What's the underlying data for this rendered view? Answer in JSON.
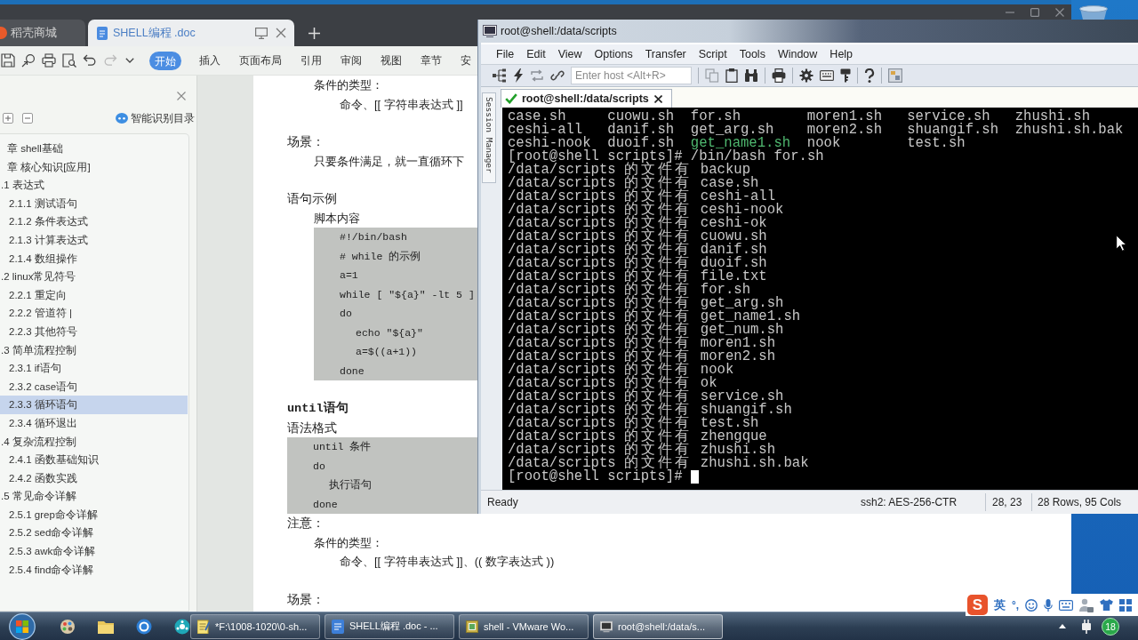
{
  "wps": {
    "tabs": [
      {
        "label": "稻壳商城",
        "selected": false
      },
      {
        "label": "SHELL编程 .doc",
        "selected": true
      }
    ],
    "quick_access": {
      "undo": {
        "disabled": false
      },
      "redo": {
        "disabled": true
      }
    },
    "ribbon_tabs": [
      {
        "label": "开始",
        "selected": true
      },
      {
        "label": "插入",
        "selected": false
      },
      {
        "label": "页面布局",
        "selected": false
      },
      {
        "label": "引用",
        "selected": false
      },
      {
        "label": "审阅",
        "selected": false
      },
      {
        "label": "视图",
        "selected": false
      },
      {
        "label": "章节",
        "selected": false
      },
      {
        "label": "安",
        "selected": false
      }
    ],
    "navigation": {
      "title": "智能识别目录",
      "items": [
        {
          "label": "章 shell基础",
          "selected": false
        },
        {
          "label": "章 核心知识[应用]",
          "selected": false,
          "children": [
            {
              "label": ".1 表达式",
              "selected": false,
              "children": [
                {
                  "label": "2.1.1 测试语句",
                  "selected": false
                },
                {
                  "label": "2.1.2 条件表达式",
                  "selected": false
                },
                {
                  "label": "2.1.3 计算表达式",
                  "selected": false
                },
                {
                  "label": "2.1.4 数组操作",
                  "selected": false
                }
              ]
            },
            {
              "label": ".2 linux常见符号",
              "selected": false,
              "children": [
                {
                  "label": "2.2.1 重定向",
                  "selected": false
                },
                {
                  "label": "2.2.2 管道符 |",
                  "selected": false
                },
                {
                  "label": "2.2.3 其他符号",
                  "selected": false
                }
              ]
            },
            {
              "label": ".3 简单流程控制",
              "selected": false,
              "children": [
                {
                  "label": "2.3.1 if语句",
                  "selected": false
                },
                {
                  "label": "2.3.2 case语句",
                  "selected": false
                },
                {
                  "label": "2.3.3 循环语句",
                  "selected": true
                },
                {
                  "label": "2.3.4 循环退出",
                  "selected": false
                }
              ]
            },
            {
              "label": ".4 复杂流程控制",
              "selected": false,
              "children": [
                {
                  "label": "2.4.1 函数基础知识",
                  "selected": false
                },
                {
                  "label": "2.4.2 函数实践",
                  "selected": false
                }
              ]
            },
            {
              "label": ".5 常见命令详解",
              "selected": false,
              "children": [
                {
                  "label": "2.5.1 grep命令详解",
                  "selected": false
                },
                {
                  "label": "2.5.2 sed命令详解",
                  "selected": false
                },
                {
                  "label": "2.5.3 awk命令详解",
                  "selected": false
                },
                {
                  "label": "2.5.4 find命令详解",
                  "selected": false
                }
              ]
            }
          ]
        }
      ]
    },
    "document": {
      "sections": [
        {
          "blocks": [
            {
              "kind": "body",
              "text": "条件的类型："
            },
            {
              "kind": "indented",
              "text": "命令、[[ 字符串表达式 ]]"
            }
          ]
        },
        {
          "blocks": [
            {
              "kind": "heading",
              "text": "场景："
            },
            {
              "kind": "body",
              "text": "只要条件满足，就一直循环下"
            }
          ]
        },
        {
          "blocks": [
            {
              "kind": "heading",
              "text": "语句示例"
            },
            {
              "kind": "body",
              "text": "脚本内容"
            },
            {
              "kind": "script",
              "lines": [
                {
                  "text": "#!/bin/bash"
                },
                {
                  "text": "# while 的示例"
                },
                {
                  "text": "a=1"
                },
                {
                  "text": "while [ \"${a}\" -lt 5 ]"
                },
                {
                  "text": "do",
                  "children": [
                    {
                      "text": "echo \"${a}\""
                    },
                    {
                      "text": "a=$((a+1))"
                    }
                  ]
                },
                {
                  "text": "done"
                }
              ]
            }
          ]
        },
        {
          "blocks": [
            {
              "kind": "title",
              "text": "until语句"
            },
            {
              "kind": "heading",
              "text": "语法格式"
            },
            {
              "kind": "syntax",
              "lines": [
                {
                  "text": "until 条件"
                },
                {
                  "text": "do",
                  "children": [
                    {
                      "text": "执行语句"
                    }
                  ]
                },
                {
                  "text": "done"
                }
              ]
            },
            {
              "kind": "heading",
              "text": "注意："
            },
            {
              "kind": "body",
              "text": "条件的类型："
            },
            {
              "kind": "indented",
              "text": "命令、[[ 字符串表达式 ]]、(( 数字表达式 ))"
            }
          ]
        },
        {
          "blocks": [
            {
              "kind": "heading",
              "text": "场景："
            }
          ]
        }
      ]
    }
  },
  "terminal": {
    "title": "root@shell:/data/scripts",
    "menu": [
      "File",
      "Edit",
      "View",
      "Options",
      "Transfer",
      "Script",
      "Tools",
      "Window",
      "Help"
    ],
    "host_field": {
      "placeholder": "Enter host <Alt+R>"
    },
    "side_tab": "Session Manager",
    "session_tabs": [
      {
        "label": "root@shell:/data/scripts",
        "selected": true,
        "connected": true
      }
    ],
    "lines": [
      {
        "kind": "ls",
        "entries": [
          {
            "name": "case.sh",
            "color": "#c8c8c8"
          },
          {
            "name": "cuowu.sh",
            "color": "#c8c8c8"
          },
          {
            "name": "for.sh",
            "color": "#c8c8c8"
          },
          {
            "name": "moren1.sh",
            "color": "#c8c8c8"
          },
          {
            "name": "service.sh",
            "color": "#c8c8c8"
          },
          {
            "name": "zhushi.sh",
            "color": "#c8c8c8"
          }
        ]
      },
      {
        "kind": "ls",
        "entries": [
          {
            "name": "ceshi-all",
            "color": "#c8c8c8"
          },
          {
            "name": "danif.sh",
            "color": "#c8c8c8"
          },
          {
            "name": "get_arg.sh",
            "color": "#c8c8c8"
          },
          {
            "name": "moren2.sh",
            "color": "#c8c8c8"
          },
          {
            "name": "shuangif.sh",
            "color": "#c8c8c8"
          },
          {
            "name": "zhushi.sh.bak",
            "color": "#c8c8c8"
          }
        ]
      },
      {
        "kind": "ls",
        "entries": [
          {
            "name": "ceshi-nook",
            "color": "#c8c8c8"
          },
          {
            "name": "duoif.sh",
            "color": "#c8c8c8"
          },
          {
            "name": "get_name1.sh",
            "color": "#4fb86f"
          },
          {
            "name": "nook",
            "color": "#c8c8c8"
          },
          {
            "name": "test.sh",
            "color": "#c8c8c8"
          }
        ]
      },
      {
        "kind": "text",
        "text": "[root@shell scripts]# /bin/bash for.sh"
      },
      {
        "kind": "text",
        "text": "/data/scripts 的文件有 backup"
      },
      {
        "kind": "text",
        "text": "/data/scripts 的文件有 case.sh"
      },
      {
        "kind": "text",
        "text": "/data/scripts 的文件有 ceshi-all"
      },
      {
        "kind": "text",
        "text": "/data/scripts 的文件有 ceshi-nook"
      },
      {
        "kind": "text",
        "text": "/data/scripts 的文件有 ceshi-ok"
      },
      {
        "kind": "text",
        "text": "/data/scripts 的文件有 cuowu.sh"
      },
      {
        "kind": "text",
        "text": "/data/scripts 的文件有 danif.sh"
      },
      {
        "kind": "text",
        "text": "/data/scripts 的文件有 duoif.sh"
      },
      {
        "kind": "text",
        "text": "/data/scripts 的文件有 file.txt"
      },
      {
        "kind": "text",
        "text": "/data/scripts 的文件有 for.sh"
      },
      {
        "kind": "text",
        "text": "/data/scripts 的文件有 get_arg.sh"
      },
      {
        "kind": "text",
        "text": "/data/scripts 的文件有 get_name1.sh"
      },
      {
        "kind": "text",
        "text": "/data/scripts 的文件有 get_num.sh"
      },
      {
        "kind": "text",
        "text": "/data/scripts 的文件有 moren1.sh"
      },
      {
        "kind": "text",
        "text": "/data/scripts 的文件有 moren2.sh"
      },
      {
        "kind": "text",
        "text": "/data/scripts 的文件有 nook"
      },
      {
        "kind": "text",
        "text": "/data/scripts 的文件有 ok"
      },
      {
        "kind": "text",
        "text": "/data/scripts 的文件有 service.sh"
      },
      {
        "kind": "text",
        "text": "/data/scripts 的文件有 shuangif.sh"
      },
      {
        "kind": "text",
        "text": "/data/scripts 的文件有 test.sh"
      },
      {
        "kind": "text",
        "text": "/data/scripts 的文件有 zhengque"
      },
      {
        "kind": "text",
        "text": "/data/scripts 的文件有 zhushi.sh"
      },
      {
        "kind": "text",
        "text": "/data/scripts 的文件有 zhushi.sh.bak"
      },
      {
        "kind": "prompt",
        "text": "[root@shell scripts]#"
      }
    ],
    "status": {
      "state": "Ready",
      "cipher": "ssh2: AES-256-CTR",
      "cursor": "28, 23",
      "size": "28 Rows, 95 Cols"
    }
  },
  "ime": {
    "logo": "S",
    "mode": "英",
    "punctuation": "°,"
  },
  "taskbar": {
    "buttons": [
      {
        "label": "*F:\\1008-1020\\0-sh...",
        "selected": false
      },
      {
        "label": "SHELL编程 .doc - ...",
        "selected": false
      },
      {
        "label": "shell - VMware Wo...",
        "selected": false
      },
      {
        "label": "root@shell:/data/s...",
        "selected": true
      }
    ],
    "tray_badge": "18"
  }
}
